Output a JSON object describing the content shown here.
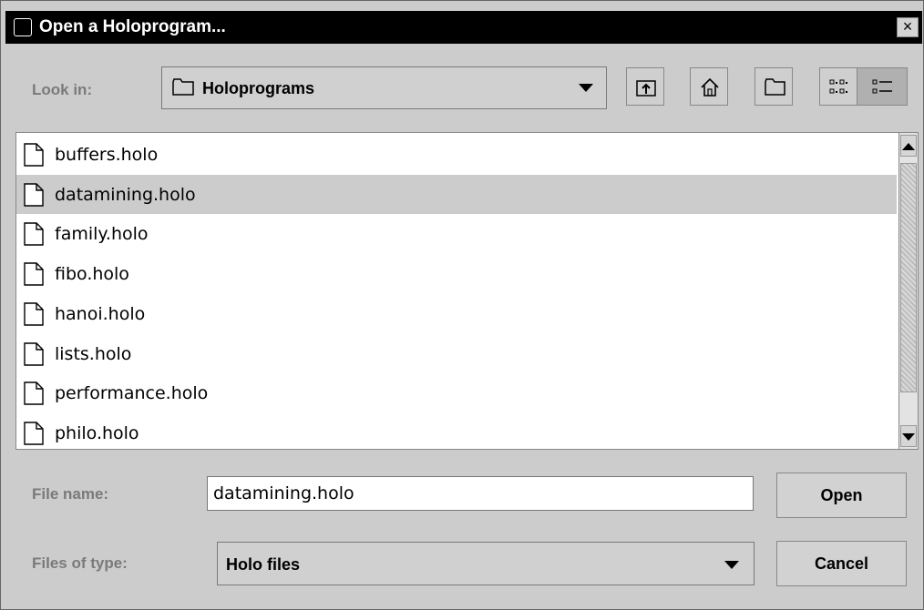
{
  "window": {
    "title": "Open a Holoprogram...",
    "close_label": "×"
  },
  "look_in": {
    "label": "Look in:",
    "value": "Holoprograms"
  },
  "toolbar": {
    "up_icon": "up-folder-icon",
    "home_icon": "home-icon",
    "new_folder_icon": "new-folder-icon",
    "list_view_icon": "list-view-icon",
    "details_view_icon": "details-view-icon"
  },
  "files": [
    {
      "name": "buffers.holo",
      "selected": false
    },
    {
      "name": "datamining.holo",
      "selected": true
    },
    {
      "name": "family.holo",
      "selected": false
    },
    {
      "name": "fibo.holo",
      "selected": false
    },
    {
      "name": "hanoi.holo",
      "selected": false
    },
    {
      "name": "lists.holo",
      "selected": false
    },
    {
      "name": "performance.holo",
      "selected": false
    },
    {
      "name": "philo.holo",
      "selected": false
    }
  ],
  "file_name": {
    "label": "File name:",
    "value": "datamining.holo"
  },
  "file_type": {
    "label": "Files of type:",
    "value": "Holo files"
  },
  "buttons": {
    "open": "Open",
    "cancel": "Cancel"
  }
}
